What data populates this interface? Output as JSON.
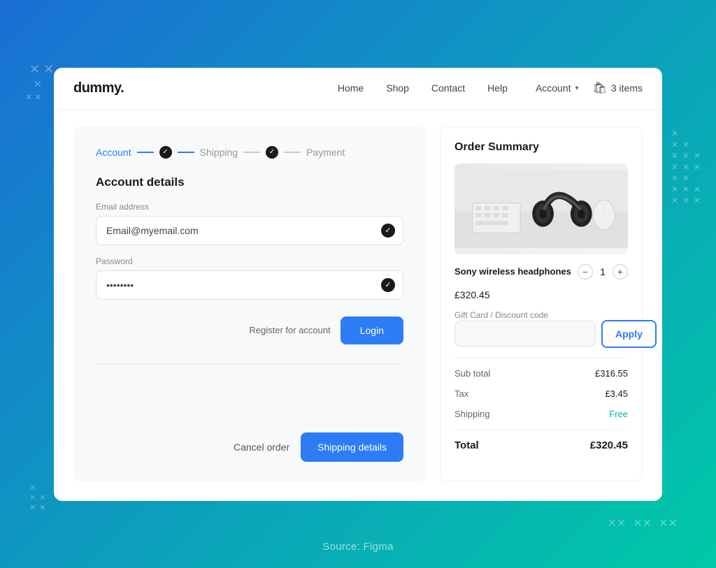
{
  "background": {
    "source_label": "Source: Figma"
  },
  "navbar": {
    "logo": "dummy.",
    "nav_links": [
      {
        "label": "Home"
      },
      {
        "label": "Shop"
      },
      {
        "label": "Contact"
      },
      {
        "label": "Help"
      }
    ],
    "account_label": "Account",
    "cart_label": "3 items"
  },
  "stepper": {
    "step1_label": "Account",
    "step2_label": "Shipping",
    "step3_label": "Payment"
  },
  "account_form": {
    "section_title": "Account details",
    "email_label": "Email address",
    "email_value": "Email@myemail.com",
    "password_label": "Password",
    "password_value": "••••••••",
    "register_label": "Register for account",
    "login_btn": "Login"
  },
  "bottom_actions": {
    "cancel_label": "Cancel order",
    "shipping_btn": "Shipping details"
  },
  "order_summary": {
    "title": "Order Summary",
    "product_name": "Sony wireless headphones",
    "product_price": "£320.45",
    "quantity": "1",
    "discount_label": "Gift Card / Discount code",
    "discount_placeholder": "",
    "apply_btn": "Apply",
    "sub_total_label": "Sub total",
    "sub_total_value": "£316.55",
    "tax_label": "Tax",
    "tax_value": "£3.45",
    "shipping_label": "Shipping",
    "shipping_value": "Free",
    "total_label": "Total",
    "total_value": "£320.45"
  }
}
